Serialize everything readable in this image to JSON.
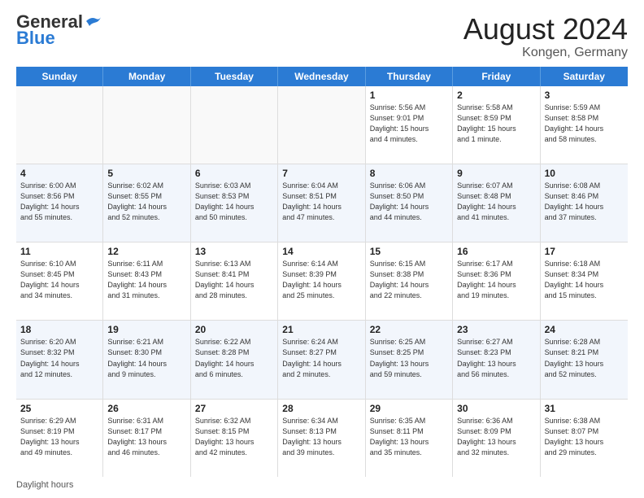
{
  "header": {
    "logo_line1": "General",
    "logo_line2": "Blue",
    "month_year": "August 2024",
    "location": "Kongen, Germany"
  },
  "days_of_week": [
    "Sunday",
    "Monday",
    "Tuesday",
    "Wednesday",
    "Thursday",
    "Friday",
    "Saturday"
  ],
  "footer": {
    "label": "Daylight hours"
  },
  "weeks": [
    [
      {
        "day": "",
        "detail": "",
        "empty": true
      },
      {
        "day": "",
        "detail": "",
        "empty": true
      },
      {
        "day": "",
        "detail": "",
        "empty": true
      },
      {
        "day": "",
        "detail": "",
        "empty": true
      },
      {
        "day": "1",
        "detail": "Sunrise: 5:56 AM\nSunset: 9:01 PM\nDaylight: 15 hours\nand 4 minutes.",
        "empty": false
      },
      {
        "day": "2",
        "detail": "Sunrise: 5:58 AM\nSunset: 8:59 PM\nDaylight: 15 hours\nand 1 minute.",
        "empty": false
      },
      {
        "day": "3",
        "detail": "Sunrise: 5:59 AM\nSunset: 8:58 PM\nDaylight: 14 hours\nand 58 minutes.",
        "empty": false
      }
    ],
    [
      {
        "day": "4",
        "detail": "Sunrise: 6:00 AM\nSunset: 8:56 PM\nDaylight: 14 hours\nand 55 minutes.",
        "empty": false
      },
      {
        "day": "5",
        "detail": "Sunrise: 6:02 AM\nSunset: 8:55 PM\nDaylight: 14 hours\nand 52 minutes.",
        "empty": false
      },
      {
        "day": "6",
        "detail": "Sunrise: 6:03 AM\nSunset: 8:53 PM\nDaylight: 14 hours\nand 50 minutes.",
        "empty": false
      },
      {
        "day": "7",
        "detail": "Sunrise: 6:04 AM\nSunset: 8:51 PM\nDaylight: 14 hours\nand 47 minutes.",
        "empty": false
      },
      {
        "day": "8",
        "detail": "Sunrise: 6:06 AM\nSunset: 8:50 PM\nDaylight: 14 hours\nand 44 minutes.",
        "empty": false
      },
      {
        "day": "9",
        "detail": "Sunrise: 6:07 AM\nSunset: 8:48 PM\nDaylight: 14 hours\nand 41 minutes.",
        "empty": false
      },
      {
        "day": "10",
        "detail": "Sunrise: 6:08 AM\nSunset: 8:46 PM\nDaylight: 14 hours\nand 37 minutes.",
        "empty": false
      }
    ],
    [
      {
        "day": "11",
        "detail": "Sunrise: 6:10 AM\nSunset: 8:45 PM\nDaylight: 14 hours\nand 34 minutes.",
        "empty": false
      },
      {
        "day": "12",
        "detail": "Sunrise: 6:11 AM\nSunset: 8:43 PM\nDaylight: 14 hours\nand 31 minutes.",
        "empty": false
      },
      {
        "day": "13",
        "detail": "Sunrise: 6:13 AM\nSunset: 8:41 PM\nDaylight: 14 hours\nand 28 minutes.",
        "empty": false
      },
      {
        "day": "14",
        "detail": "Sunrise: 6:14 AM\nSunset: 8:39 PM\nDaylight: 14 hours\nand 25 minutes.",
        "empty": false
      },
      {
        "day": "15",
        "detail": "Sunrise: 6:15 AM\nSunset: 8:38 PM\nDaylight: 14 hours\nand 22 minutes.",
        "empty": false
      },
      {
        "day": "16",
        "detail": "Sunrise: 6:17 AM\nSunset: 8:36 PM\nDaylight: 14 hours\nand 19 minutes.",
        "empty": false
      },
      {
        "day": "17",
        "detail": "Sunrise: 6:18 AM\nSunset: 8:34 PM\nDaylight: 14 hours\nand 15 minutes.",
        "empty": false
      }
    ],
    [
      {
        "day": "18",
        "detail": "Sunrise: 6:20 AM\nSunset: 8:32 PM\nDaylight: 14 hours\nand 12 minutes.",
        "empty": false
      },
      {
        "day": "19",
        "detail": "Sunrise: 6:21 AM\nSunset: 8:30 PM\nDaylight: 14 hours\nand 9 minutes.",
        "empty": false
      },
      {
        "day": "20",
        "detail": "Sunrise: 6:22 AM\nSunset: 8:28 PM\nDaylight: 14 hours\nand 6 minutes.",
        "empty": false
      },
      {
        "day": "21",
        "detail": "Sunrise: 6:24 AM\nSunset: 8:27 PM\nDaylight: 14 hours\nand 2 minutes.",
        "empty": false
      },
      {
        "day": "22",
        "detail": "Sunrise: 6:25 AM\nSunset: 8:25 PM\nDaylight: 13 hours\nand 59 minutes.",
        "empty": false
      },
      {
        "day": "23",
        "detail": "Sunrise: 6:27 AM\nSunset: 8:23 PM\nDaylight: 13 hours\nand 56 minutes.",
        "empty": false
      },
      {
        "day": "24",
        "detail": "Sunrise: 6:28 AM\nSunset: 8:21 PM\nDaylight: 13 hours\nand 52 minutes.",
        "empty": false
      }
    ],
    [
      {
        "day": "25",
        "detail": "Sunrise: 6:29 AM\nSunset: 8:19 PM\nDaylight: 13 hours\nand 49 minutes.",
        "empty": false
      },
      {
        "day": "26",
        "detail": "Sunrise: 6:31 AM\nSunset: 8:17 PM\nDaylight: 13 hours\nand 46 minutes.",
        "empty": false
      },
      {
        "day": "27",
        "detail": "Sunrise: 6:32 AM\nSunset: 8:15 PM\nDaylight: 13 hours\nand 42 minutes.",
        "empty": false
      },
      {
        "day": "28",
        "detail": "Sunrise: 6:34 AM\nSunset: 8:13 PM\nDaylight: 13 hours\nand 39 minutes.",
        "empty": false
      },
      {
        "day": "29",
        "detail": "Sunrise: 6:35 AM\nSunset: 8:11 PM\nDaylight: 13 hours\nand 35 minutes.",
        "empty": false
      },
      {
        "day": "30",
        "detail": "Sunrise: 6:36 AM\nSunset: 8:09 PM\nDaylight: 13 hours\nand 32 minutes.",
        "empty": false
      },
      {
        "day": "31",
        "detail": "Sunrise: 6:38 AM\nSunset: 8:07 PM\nDaylight: 13 hours\nand 29 minutes.",
        "empty": false
      }
    ]
  ]
}
